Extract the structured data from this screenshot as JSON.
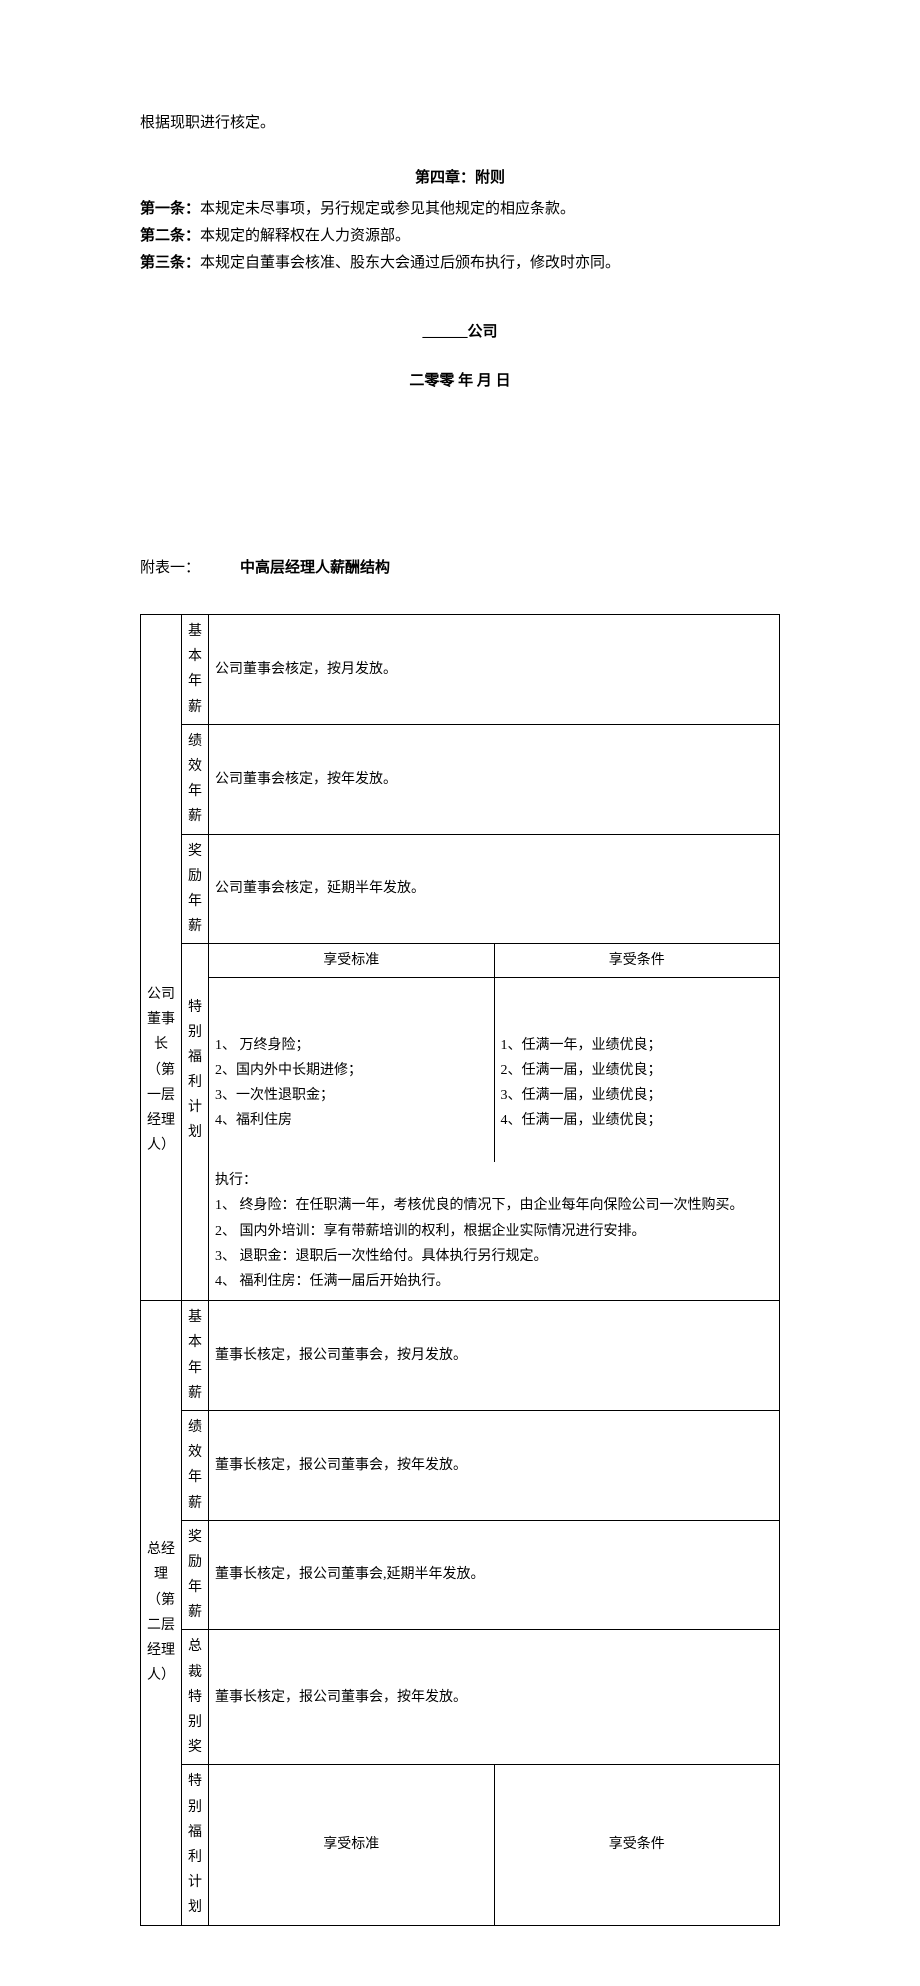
{
  "intro_para": "根据现职进行核定。",
  "chapter4_title": "第四章：附则",
  "articles": [
    {
      "label": "第一条：",
      "text": "本规定未尽事项，另行规定或参见其他规定的相应条款。"
    },
    {
      "label": "第二条：",
      "text": "本规定的解释权在人力资源部。"
    },
    {
      "label": "第三条：",
      "text": "本规定自董事会核准、股东大会通过后颁布执行，修改时亦同。"
    }
  ],
  "company_line": "______公司",
  "date_line": "二零零 年 月 日",
  "attach_label": "附表一：",
  "attach_title": "中高层经理人薪酬结构",
  "roles": {
    "r1": "公司董事长（第一层经理人）",
    "r2": "总经理（第二层经理人）"
  },
  "items": {
    "basic": "基本年薪",
    "perf": "绩效年薪",
    "bonus": "奖励年薪",
    "pres_award": "总裁特别奖",
    "welfare": "特别福利计划"
  },
  "headers": {
    "standard": "享受标准",
    "condition": "享受条件"
  },
  "r1": {
    "basic": "公司董事会核定，按月发放。",
    "perf": "公司董事会核定，按年发放。",
    "bonus": "公司董事会核定，延期半年发放。",
    "std1": "1、  万终身险；",
    "std2": "2、国内外中长期进修；",
    "std3": "3、一次性退职金；",
    "std4": "4、福利住房",
    "cond1": "1、任满一年，业绩优良；",
    "cond2": "2、任满一届，业绩优良；",
    "cond3": "3、任满一届，业绩优良；",
    "cond4": "4、任满一届，业绩优良；",
    "exec_title": "执行：",
    "exec1": "1、  终身险：在任职满一年，考核优良的情况下，由企业每年向保险公司一次性购买。",
    "exec2": "2、  国内外培训：享有带薪培训的权利，根据企业实际情况进行安排。",
    "exec3": "3、  退职金：退职后一次性给付。具体执行另行规定。",
    "exec4": "4、  福利住房：任满一届后开始执行。"
  },
  "r2": {
    "basic": "董事长核定，报公司董事会，按月发放。",
    "perf": "董事长核定，报公司董事会，按年发放。",
    "bonus": "董事长核定，报公司董事会,延期半年发放。",
    "pres_award": "董事长核定，报公司董事会，按年发放。"
  }
}
